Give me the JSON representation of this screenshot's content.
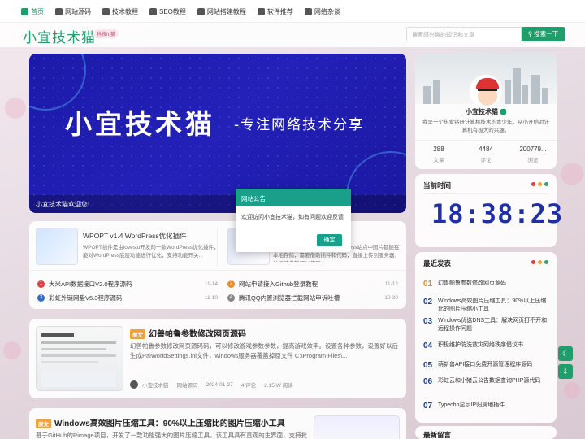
{
  "nav": {
    "items": [
      {
        "label": "首页",
        "icon": "home-icon",
        "active": true
      },
      {
        "label": "网站源码",
        "icon": "code-icon"
      },
      {
        "label": "技术教程",
        "icon": "book-icon"
      },
      {
        "label": "SEO教程",
        "icon": "seo-icon"
      },
      {
        "label": "网站搭建教程",
        "icon": "globe-icon"
      },
      {
        "label": "软件推荐",
        "icon": "cloud-icon"
      },
      {
        "label": "网络杂谈",
        "icon": "chat-icon"
      }
    ]
  },
  "header": {
    "logo": "小宜技术猫",
    "logo_sub": "科技fu猫",
    "search_placeholder": "搜索感兴趣的知识和文章",
    "search_button": "搜索一下"
  },
  "banner": {
    "title": "小宜技术猫",
    "subtitle": "-专注网络技术分享",
    "caption": "小宜技术猫欢迎您!"
  },
  "featured": {
    "left": {
      "title": "WPOPT v1.4 WordPress优化插件",
      "desc": "WPOPT插件是由lovestu开发的一款WordPress优化插件，能对WordPress底层功能进行优化，支持功能开关..."
    },
    "right": {
      "desc": "插件主要是为了解决当前WordPress站点中图片都能在本地存储，需要借助插件和代码，直接上传到服务器，访问域名就可以使用。..."
    },
    "list": [
      {
        "num": "1",
        "title": "大米API数据接口V2.0程序源码",
        "date": "11-14",
        "color": "#e53e3e"
      },
      {
        "num": "2",
        "title": "网站申请接入Github登录教程",
        "date": "11-12",
        "color": "#f08a24"
      },
      {
        "num": "3",
        "title": "彩虹外链网盘V5.3程序源码",
        "date": "11-10",
        "color": "#2b6cd0"
      },
      {
        "num": "4",
        "title": "腾讯QQ内置浏览器拦截网站申诉吐槽",
        "date": "10-30",
        "color": "#888888"
      }
    ]
  },
  "post1": {
    "tag": "原文",
    "title": "幻兽帕鲁参数修改网页源码",
    "desc": "幻兽帕鲁参数修改网页源码码，可以修改游戏参数参数，提高游戏效率。设置各种参数，设置好以后生成PalWorldSettings.ini文件，windows服务器覆盖掉原文件 C:\\Program Files\\...",
    "author": "小宜技术猫",
    "category": "网站源码",
    "date": "2024-01-27",
    "comments": "4 评论",
    "views": "2.15 W 阅读"
  },
  "post2": {
    "tag": "原文",
    "title": "Windows高效图片压缩工具：90%以上压缩比的图片压缩小工具",
    "desc": "基于GitHub的Rimage项目，开发了一款功能强大的图片压缩工具，该工具具有直观的主界面，支持批量选..."
  },
  "profile": {
    "name": "小宜技术猫",
    "desc": "我是一个热爱钻研计算机技术的青少年，从小开始对计算机有极大的兴趣。",
    "stats": [
      {
        "value": "288",
        "label": "文章"
      },
      {
        "value": "4484",
        "label": "评论"
      },
      {
        "value": "200779...",
        "label": "浏览"
      }
    ]
  },
  "clock": {
    "title": "当前时间",
    "time": "18:38:23"
  },
  "recent": {
    "title": "最近发表",
    "items": [
      {
        "num": "01",
        "title": "幻兽帕鲁参数修改网页源码"
      },
      {
        "num": "02",
        "title": "Windows高效图片压缩工具：90%以上压缩比的图片压缩小工具"
      },
      {
        "num": "03",
        "title": "Windows优选DNS工具：解决网页打不开和远程操作问题"
      },
      {
        "num": "04",
        "title": "积极维护防洗救灾网络秩序倡议书"
      },
      {
        "num": "05",
        "title": "萌新兽API接口免费开源管理程序源码"
      },
      {
        "num": "06",
        "title": "彩虹云和小猪云公告数据查询PHP源代码"
      },
      {
        "num": "07",
        "title": "Typecho显示IP归属地插件"
      }
    ]
  },
  "comments": {
    "title": "最新留言"
  },
  "modal": {
    "title": "网站公告",
    "body": "欢迎访问小宜技术猫，如有问题欢迎反馈",
    "button": "确定"
  },
  "colors": {
    "accent": "#1f9d6b",
    "modal": "#1aa08a",
    "banner": "#2321b8"
  }
}
